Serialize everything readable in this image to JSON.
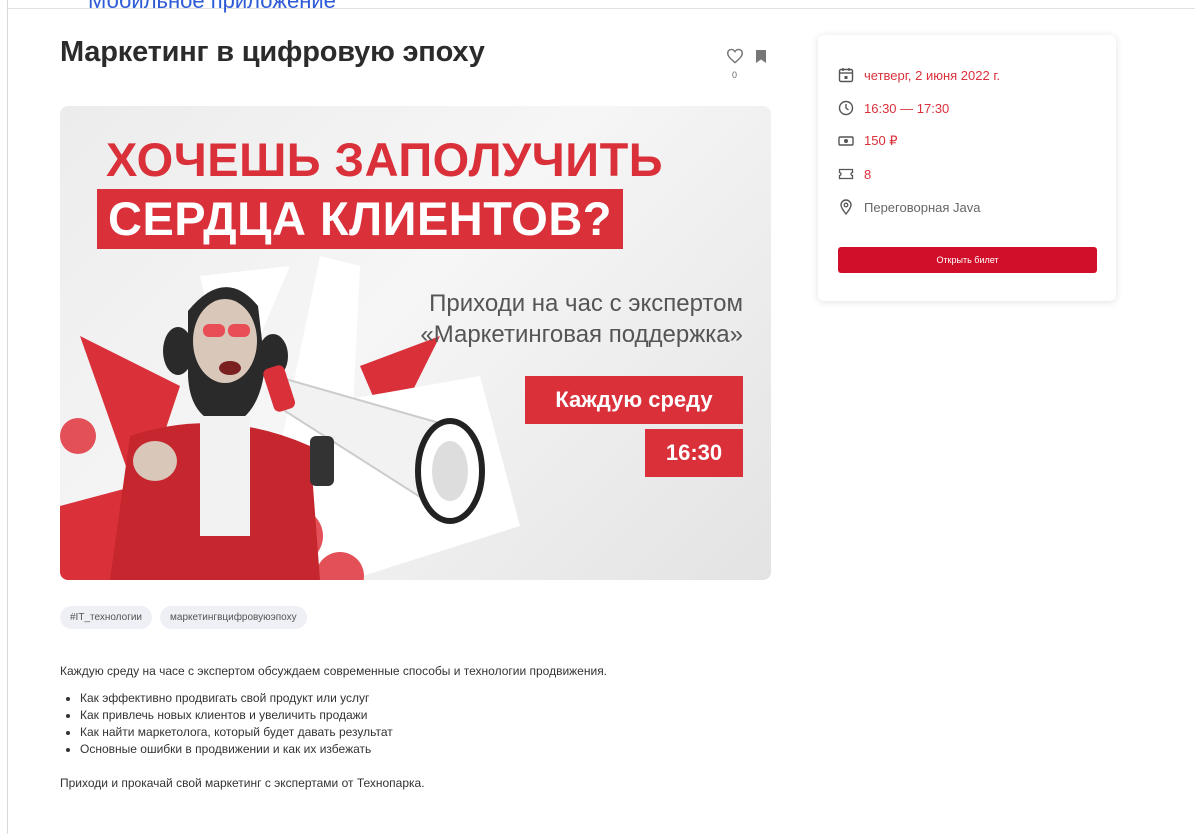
{
  "header": {
    "partial_link": "Мобильное приложение"
  },
  "event": {
    "title": "Маркетинг в цифровую эпоху",
    "likes": "0",
    "banner": {
      "headline_1": "ХОЧЕШЬ ЗАПОЛУЧИТЬ",
      "headline_2": "СЕРДЦА КЛИЕНТОВ?",
      "sub_1": "Приходи на час с экспертом",
      "sub_2": "«Маркетинговая поддержка»",
      "day": "Каждую среду",
      "time": "16:30"
    },
    "tags": [
      "#IT_технологии",
      "маркетингвцифровуюэпоху"
    ],
    "description": {
      "intro": "Каждую среду на часе с экспертом обсуждаем современные способы и технологии продвижения.",
      "bullets": [
        "Как эффективно продвигать свой продукт или услуг",
        "Как привлечь новых клиентов и увеличить продажи",
        "Как найти маркетолога, который будет давать результат",
        "Основные ошибки в продвижении и как их избежать"
      ],
      "outro": "Приходи и прокачай свой маркетинг с экспертами от Технопарка."
    }
  },
  "info_card": {
    "date": "четверг, 2 июня 2022 г.",
    "time": "16:30 — 17:30",
    "price": "150 ₽",
    "tickets": "8",
    "location": "Переговорная Java",
    "button_label": "Открыть билет"
  },
  "colors": {
    "accent": "#d9303a",
    "button": "#d10f2a",
    "link": "#2e5bd6"
  },
  "icons": [
    "heart-icon",
    "bookmark-icon",
    "calendar-icon",
    "clock-icon",
    "money-icon",
    "ticket-icon",
    "location-pin-icon"
  ]
}
